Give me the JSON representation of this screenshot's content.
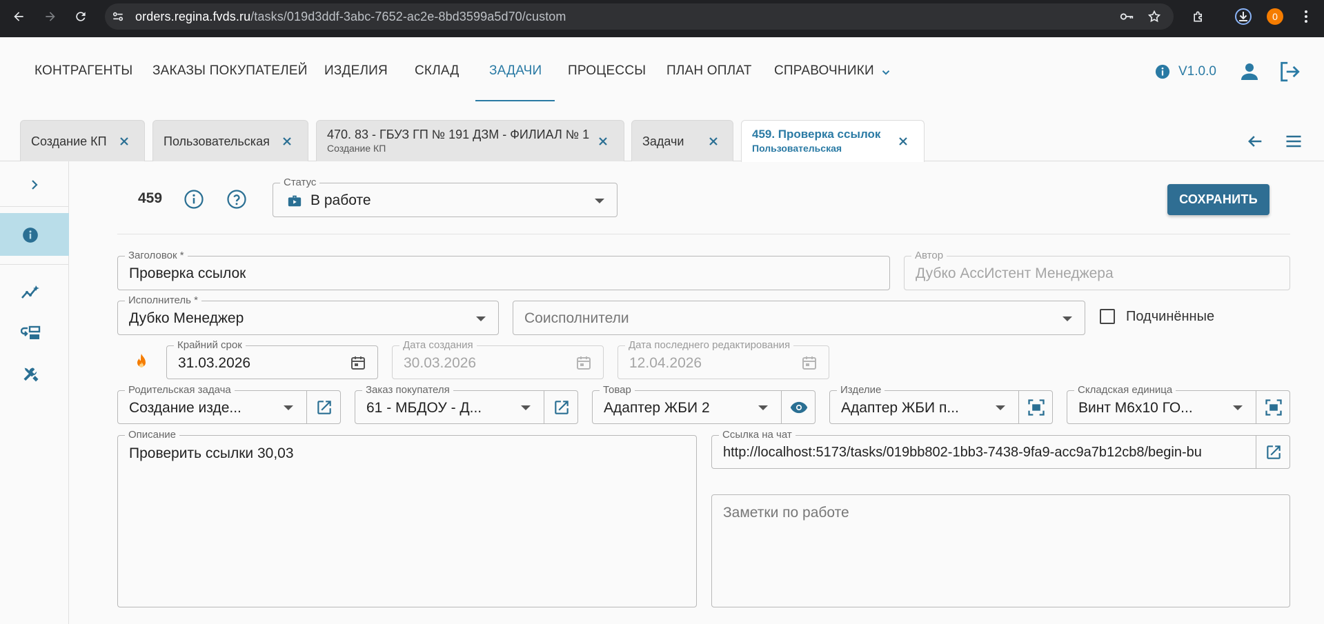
{
  "browser": {
    "url_host": "orders.regina.fvds.ru",
    "url_path": "/tasks/019d3ddf-3abc-7652-ac2e-8bd3599a5d70/custom",
    "profile_badge": "0"
  },
  "nav": {
    "items": [
      {
        "label": "КОНТРАГЕНТЫ"
      },
      {
        "label": "ЗАКАЗЫ ПОКУПАТЕЛЕЙ"
      },
      {
        "label": "ИЗДЕЛИЯ"
      },
      {
        "label": "СКЛАД"
      },
      {
        "label": "ЗАДАЧИ",
        "active": true
      },
      {
        "label": "ПРОЦЕССЫ"
      },
      {
        "label": "ПЛАН ОПЛАТ"
      },
      {
        "label": "СПРАВОЧНИКИ"
      }
    ],
    "version": "V1.0.0",
    "accent": "#2a7aa4"
  },
  "tabs": [
    {
      "label": "Создание КП"
    },
    {
      "label": "Пользовательская"
    },
    {
      "label": "470. 83 - ГБУЗ ГП № 191 ДЗМ - ФИЛИАЛ № 1",
      "sub": "Создание КП"
    },
    {
      "label": "Задачи"
    },
    {
      "label": "459. Проверка ссылок",
      "sub": "Пользовательская",
      "active": true
    }
  ],
  "task": {
    "number": "459",
    "status_label": "Статус",
    "status_value": "В работе",
    "save_label": "СОХРАНИТЬ",
    "title_label": "Заголовок *",
    "title_value": "Проверка ссылок",
    "author_label": "Автор",
    "author_value": "Дубко АссИстент Менеджера",
    "assignee_label": "Исполнитель *",
    "assignee_value": "Дубко Менеджер",
    "coassignees_placeholder": "Соисполнители",
    "subordinates_label": "Подчинённые",
    "deadline_label": "Крайний срок",
    "deadline_value": "31.03.2026",
    "created_label": "Дата создания",
    "created_value": "30.03.2026",
    "edited_label": "Дата последнего редактирования",
    "edited_value": "12.04.2026",
    "parent_label": "Родительская задача",
    "parent_value": "Создание изде...",
    "order_label": "Заказ покупателя",
    "order_value": "61 - МБДОУ - Д...",
    "goods_label": "Товар",
    "goods_value": "Адаптер ЖБИ 2",
    "product_label": "Изделие",
    "product_value": "Адаптер ЖБИ п...",
    "stock_label": "Складская единица",
    "stock_value": "Винт М6х10  ГО...",
    "description_label": "Описание",
    "description_value": "Проверить ссылки 30,03",
    "chat_label": "Ссылка на чат",
    "chat_value": "http://localhost:5173/tasks/019bb802-1bb3-7438-9fa9-acc9a7b12cb8/begin-bu",
    "notes_placeholder": "Заметки по работе"
  }
}
